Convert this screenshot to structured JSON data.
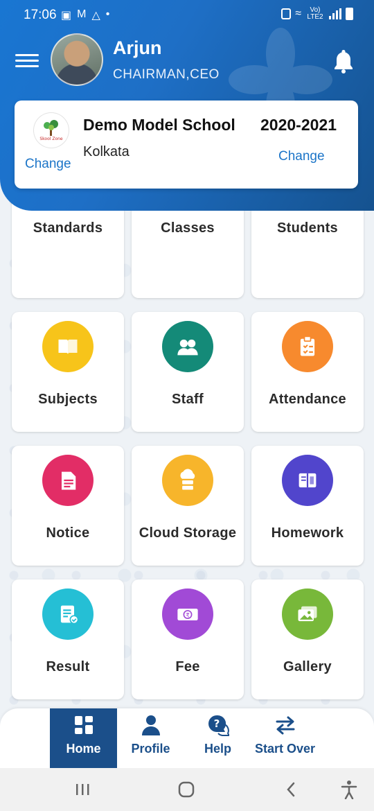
{
  "status_bar": {
    "time": "17:06",
    "network": "Vo) LTE2"
  },
  "user": {
    "name": "Arjun",
    "role": "CHAIRMAN,CEO"
  },
  "school": {
    "logo_text": "Skool Zone",
    "name": "Demo Model School",
    "year": "2020-2021",
    "city": "Kolkata",
    "change_logo_label": "Change",
    "change_year_label": "Change"
  },
  "tiles": [
    {
      "label": "Standards",
      "color": "#a052d6",
      "icon": "presentation-icon"
    },
    {
      "label": "Classes",
      "color": "#5b4fd6",
      "icon": "books-icon"
    },
    {
      "label": "Students",
      "color": "#4ba838",
      "icon": "student-icon"
    },
    {
      "label": "Subjects",
      "color": "#f7c41a",
      "icon": "book-icon"
    },
    {
      "label": "Staff",
      "color": "#148a78",
      "icon": "teachers-icon"
    },
    {
      "label": "Attendance",
      "color": "#f78a2e",
      "icon": "clipboard-icon"
    },
    {
      "label": "Notice",
      "color": "#e22d66",
      "icon": "notice-icon"
    },
    {
      "label": "Cloud Storage",
      "color": "#f7b52b",
      "icon": "cloud-server-icon"
    },
    {
      "label": "Homework",
      "color": "#5145cc",
      "icon": "notebook-icon"
    },
    {
      "label": "Result",
      "color": "#25bfd5",
      "icon": "result-icon"
    },
    {
      "label": "Fee",
      "color": "#a14ad6",
      "icon": "rupee-icon"
    },
    {
      "label": "Gallery",
      "color": "#78b83a",
      "icon": "photos-icon"
    }
  ],
  "bottom_nav": [
    {
      "label": "Home",
      "icon": "grid-icon",
      "active": true
    },
    {
      "label": "Profile",
      "icon": "person-icon",
      "active": false
    },
    {
      "label": "Help",
      "icon": "help-icon",
      "active": false
    },
    {
      "label": "Start Over",
      "icon": "swap-icon",
      "active": false
    }
  ],
  "colors": {
    "header_start": "#1976d2",
    "header_end": "#15528f",
    "link": "#1c75c8",
    "nav_active": "#1b4f8a"
  }
}
